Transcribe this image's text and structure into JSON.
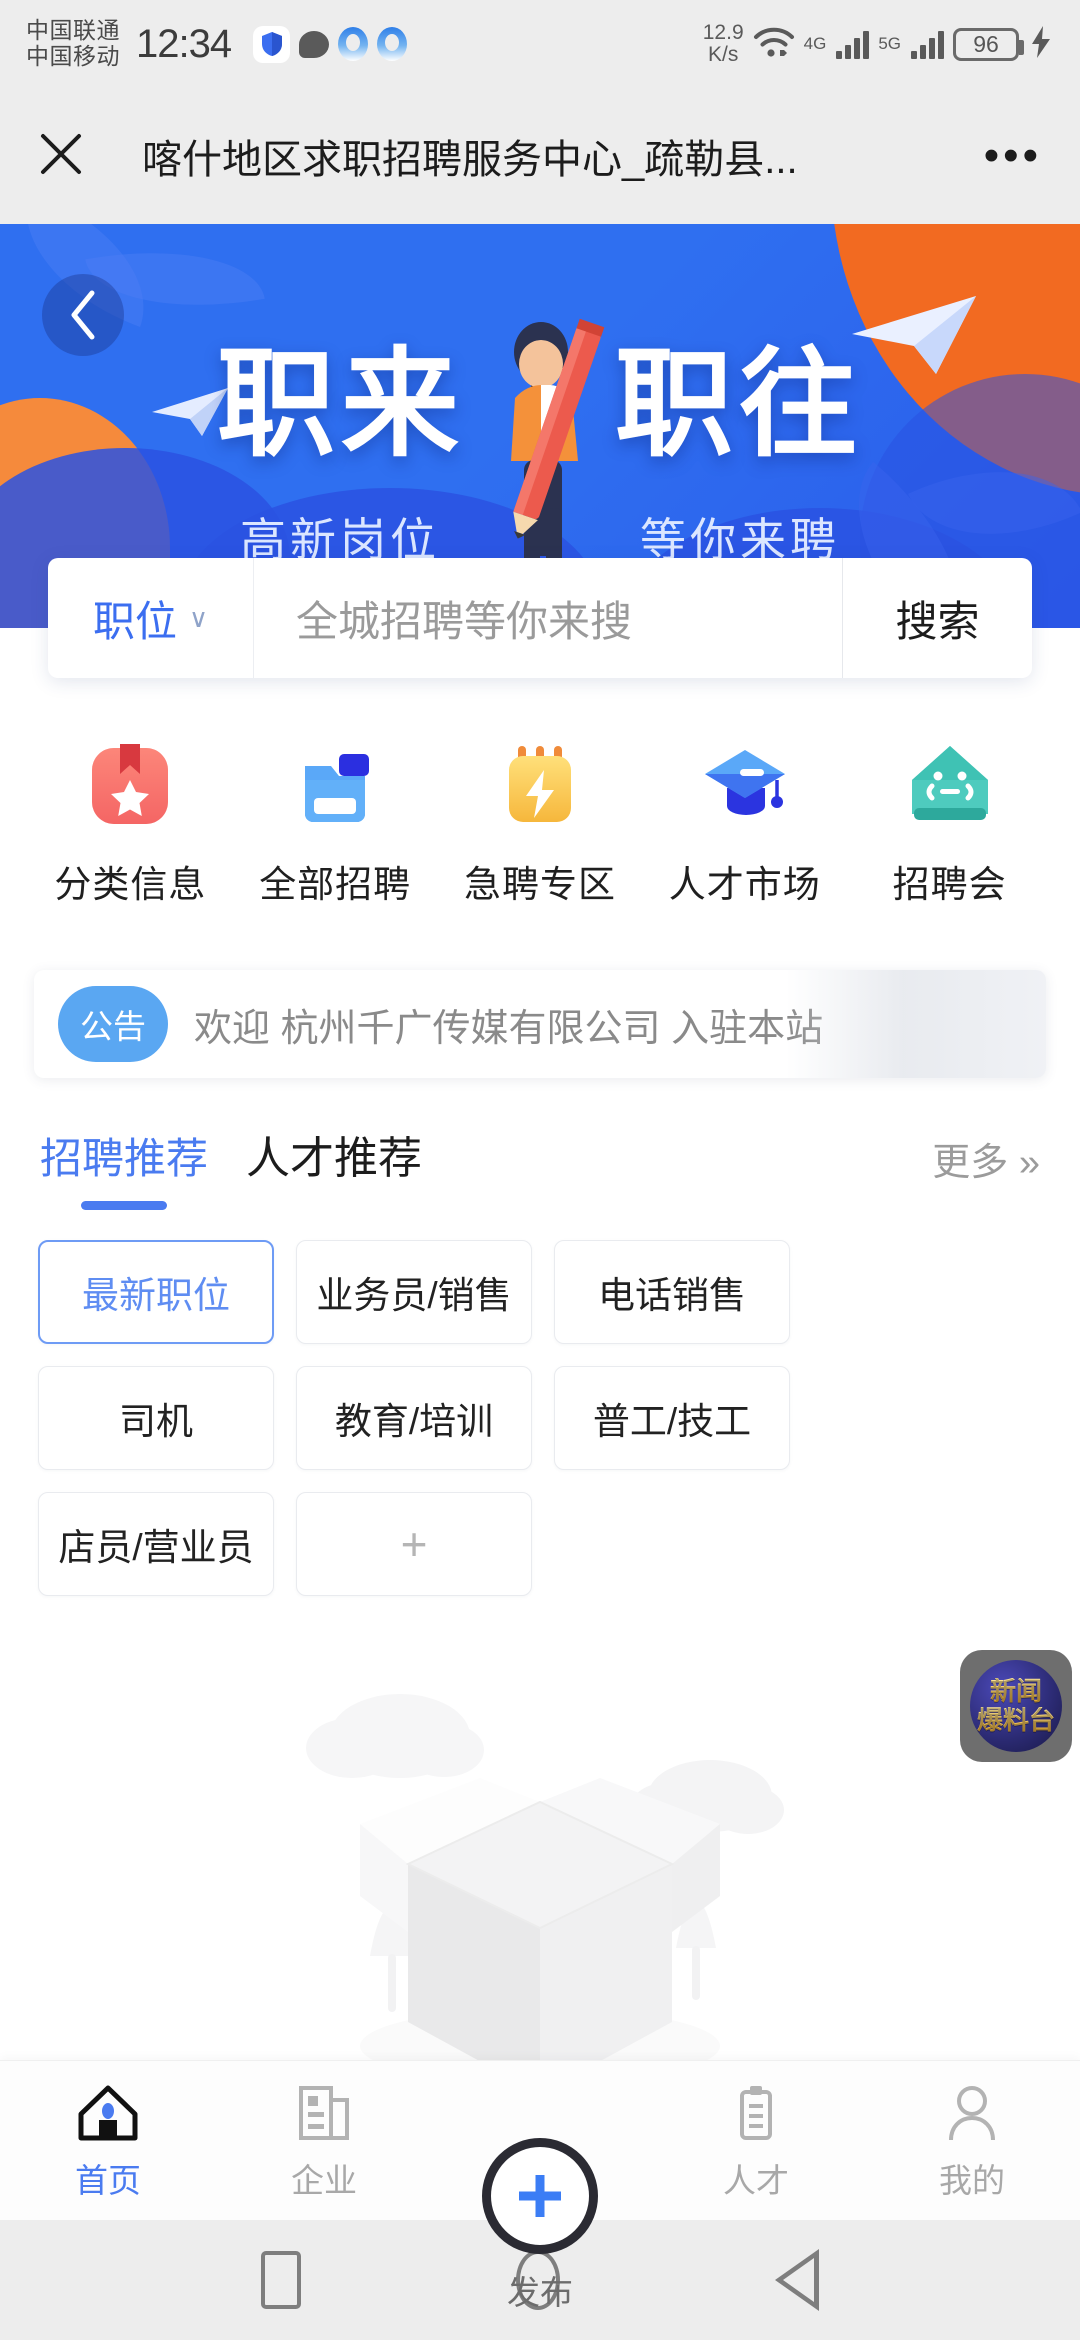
{
  "status_bar": {
    "carrier_1": "中国联通",
    "carrier_2": "中国移动",
    "time": "12:34",
    "net_speed_value": "12.9",
    "net_speed_unit": "K/s",
    "mobile_label_1": "4G",
    "mobile_label_2": "5G",
    "battery_percent": "96"
  },
  "app_bar": {
    "title": "喀什地区求职招聘服务中心_疏勒县...",
    "close_label": "✕",
    "menu_label": "•••"
  },
  "banner": {
    "headline_left": "职来",
    "headline_right": "职往",
    "sub_left": "高新岗位",
    "sub_right": "等你来聘",
    "back_label": "‹",
    "colors": {
      "blue": "#2f6ff0",
      "deep_blue": "#2a52e2",
      "orange": "#f26a21"
    }
  },
  "search": {
    "category": "职位",
    "chevron": "∨",
    "placeholder": "全城招聘等你来搜",
    "button": "搜索",
    "accent": "#3b6ef0"
  },
  "quick_links": [
    {
      "label": "分类信息",
      "icon": "bookmark-star-icon",
      "color": "#f9716f"
    },
    {
      "label": "全部招聘",
      "icon": "folder-icon",
      "color": "#54a8f7"
    },
    {
      "label": "急聘专区",
      "icon": "calendar-bolt-icon",
      "color": "#f7c948"
    },
    {
      "label": "人才市场",
      "icon": "graduation-cap-icon",
      "color": "#4a84f5"
    },
    {
      "label": "招聘会",
      "icon": "house-people-icon",
      "color": "#3fc2b4"
    }
  ],
  "notice": {
    "badge": "公告",
    "text": "欢迎 杭州千广传媒有限公司 入驻本站"
  },
  "section": {
    "tabs": [
      {
        "label": "招聘推荐",
        "active": true
      },
      {
        "label": "人才推荐",
        "active": false
      }
    ],
    "more": "更多 »"
  },
  "chips": [
    {
      "label": "最新职位",
      "active": true
    },
    {
      "label": "业务员/销售",
      "active": false
    },
    {
      "label": "电话销售",
      "active": false
    },
    {
      "label": "司机",
      "active": false
    },
    {
      "label": "教育/培训",
      "active": false
    },
    {
      "label": "普工/技工",
      "active": false
    },
    {
      "label": "店员/营业员",
      "active": false
    },
    {
      "label": "+",
      "active": false,
      "is_plus": true
    }
  ],
  "empty_state": {
    "illustration": "open-empty-box-icon"
  },
  "news_fab": {
    "line1": "新闻",
    "line2": "爆料台"
  },
  "bottom_nav": {
    "items": [
      {
        "label": "首页",
        "icon": "home-icon",
        "active": true
      },
      {
        "label": "企业",
        "icon": "building-icon",
        "active": false
      },
      {
        "label": "发布",
        "icon": "plus-circle-icon",
        "active": false
      },
      {
        "label": "人才",
        "icon": "clipboard-icon",
        "active": false
      },
      {
        "label": "我的",
        "icon": "person-icon",
        "active": false
      }
    ],
    "accent": "#4a7bf0"
  },
  "android_nav": {
    "recents": "recents-square-icon",
    "home": "home-circle-icon",
    "back": "back-triangle-icon"
  }
}
